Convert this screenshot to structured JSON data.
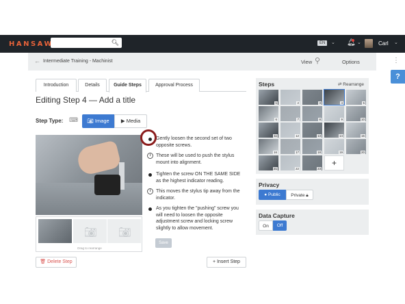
{
  "topbar": {
    "logo": "HANSAW",
    "search_placeholder": "",
    "language": "EN",
    "user_name": "Carl"
  },
  "subbar": {
    "breadcrumb": "Intermediate Training - Machinist",
    "view_label": "View",
    "options_label": "Options"
  },
  "help_label": "?",
  "tabs": [
    "Introduction",
    "Details",
    "Guide Steps",
    "Approval Process"
  ],
  "page_title": "Editing Step 4 — Add a title",
  "step_type": {
    "label": "Step Type:",
    "image_label": "Image",
    "media_label": "Media"
  },
  "thumbnails_note": "Drag to rearrange",
  "bullets": [
    {
      "kind": "bullet",
      "text": "Gently loosen the second set of two opposite screws."
    },
    {
      "kind": "info",
      "text": "These will be used to push the stylus mount into alignment."
    },
    {
      "kind": "bullet",
      "text": "Tighten the screw ON THE SAME SIDE as the highest indicator reading."
    },
    {
      "kind": "info",
      "text": "This moves the stylus tip away from the indicator."
    },
    {
      "kind": "bullet",
      "text": "As you tighten the \"pushing\" screw you will need to loosen the opposite adjustment screw and locking screw slightly to allow movement."
    }
  ],
  "save_label": "Save",
  "delete_label": "Delete Step",
  "insert_label": "Insert Step",
  "steps_panel": {
    "title": "Steps",
    "rearrange_label": "Rearrange",
    "step_numbers": [
      "1",
      "2",
      "3",
      "4",
      "5",
      "6",
      "7",
      "8",
      "9",
      "10",
      "11",
      "12",
      "13",
      "14",
      "15",
      "16",
      "17",
      "18",
      "19",
      "20",
      "21",
      "22",
      "23"
    ],
    "selected_step": "4",
    "add_label": "+"
  },
  "privacy": {
    "title": "Privacy",
    "public_label": "Public",
    "private_label": "Private",
    "selected": "Public"
  },
  "data_capture": {
    "title": "Data Capture",
    "on_label": "On",
    "off_label": "Off",
    "selected": "Off"
  },
  "colors": {
    "topbar": "#1f2429",
    "logo": "#e8633a",
    "accent": "#3d7ad1",
    "delete": "#d9534f",
    "highlight_ring": "#8b1c1c"
  }
}
